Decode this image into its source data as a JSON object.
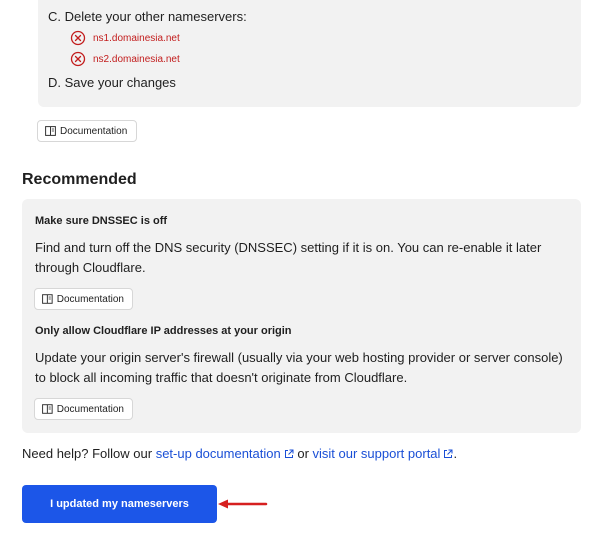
{
  "nameserver_steps": {
    "step_c": "C. Delete your other nameservers:",
    "nameservers": [
      "ns1.domainesia.net",
      "ns2.domainesia.net"
    ],
    "step_d": "D. Save your changes"
  },
  "documentation_label": "Documentation",
  "recommended": {
    "title": "Recommended",
    "items": [
      {
        "heading": "Make sure DNSSEC is off",
        "description": "Find and turn off the DNS security (DNSSEC) setting if it is on. You can re-enable it later through Cloudflare."
      },
      {
        "heading": "Only allow Cloudflare IP addresses at your origin",
        "description": "Update your origin server's firewall (usually via your web hosting provider or server console) to block all incoming traffic that doesn't originate from Cloudflare."
      }
    ]
  },
  "help": {
    "prefix": "Need help? Follow our ",
    "setup_link": "set-up documentation",
    "middle": " or ",
    "support_link": "visit our support portal",
    "suffix": "."
  },
  "primary_button": "I updated my nameservers",
  "colors": {
    "accent": "#1c56e8",
    "link": "#1a4fd6",
    "error": "#c21d1d",
    "annotation_arrow": "#d61f1f",
    "panel": "#f2f2f2"
  }
}
